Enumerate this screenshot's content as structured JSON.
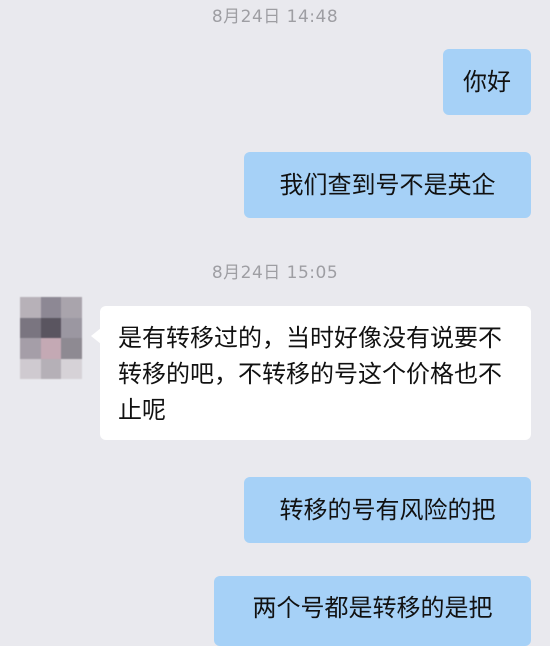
{
  "conversation": {
    "timestamps": [
      "8月24日 14:48",
      "8月24日 15:05"
    ],
    "messages": [
      {
        "sender": "me",
        "text": "你好"
      },
      {
        "sender": "me",
        "text": "我们查到号不是英企"
      },
      {
        "sender": "contact",
        "text": "是有转移过的，当时好像没有说要不转移的吧，不转移的号这个价格也不止呢"
      },
      {
        "sender": "me",
        "text": "转移的号有风险的把"
      },
      {
        "sender": "me",
        "text": "两个号都是转移的是把"
      }
    ]
  },
  "colors": {
    "background": "#e9e9ee",
    "outgoing_bubble": "#a6d1f7",
    "incoming_bubble": "#ffffff",
    "timestamp_text": "#9e9ea3"
  },
  "avatar": {
    "icon": "pixelated-avatar",
    "pixel_colors": [
      "#b7b1b8",
      "#8d8894",
      "#a9a4ac",
      "#7a7580",
      "#5a5560",
      "#9b97a1",
      "#a59ea8",
      "#c4a9b4",
      "#8e8a92",
      "#cfcad0",
      "#b5b0b7",
      "#d6d2d7"
    ]
  }
}
